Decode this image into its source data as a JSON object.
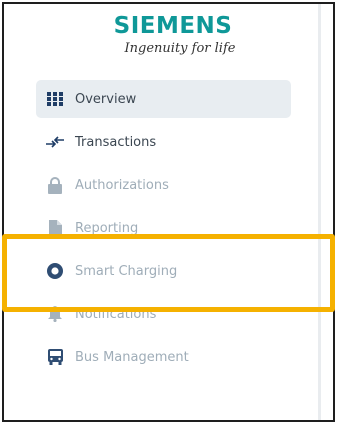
{
  "brand": {
    "name": "SIEMENS",
    "tagline": "Ingenuity for life",
    "color": "#0f9898"
  },
  "nav": {
    "items": [
      {
        "label": "Overview",
        "icon": "grid-icon",
        "active": true
      },
      {
        "label": "Transactions",
        "icon": "transfer-arrows-icon"
      },
      {
        "label": "Authorizations",
        "icon": "lock-icon"
      },
      {
        "label": "Reporting",
        "icon": "document-icon"
      },
      {
        "label": "Smart Charging",
        "icon": "gauge-icon"
      },
      {
        "label": "Notifications",
        "icon": "bell-icon"
      },
      {
        "label": "Bus Management",
        "icon": "bus-icon"
      }
    ]
  },
  "highlight": {
    "color": "#f5b100",
    "target": "Smart Charging"
  }
}
